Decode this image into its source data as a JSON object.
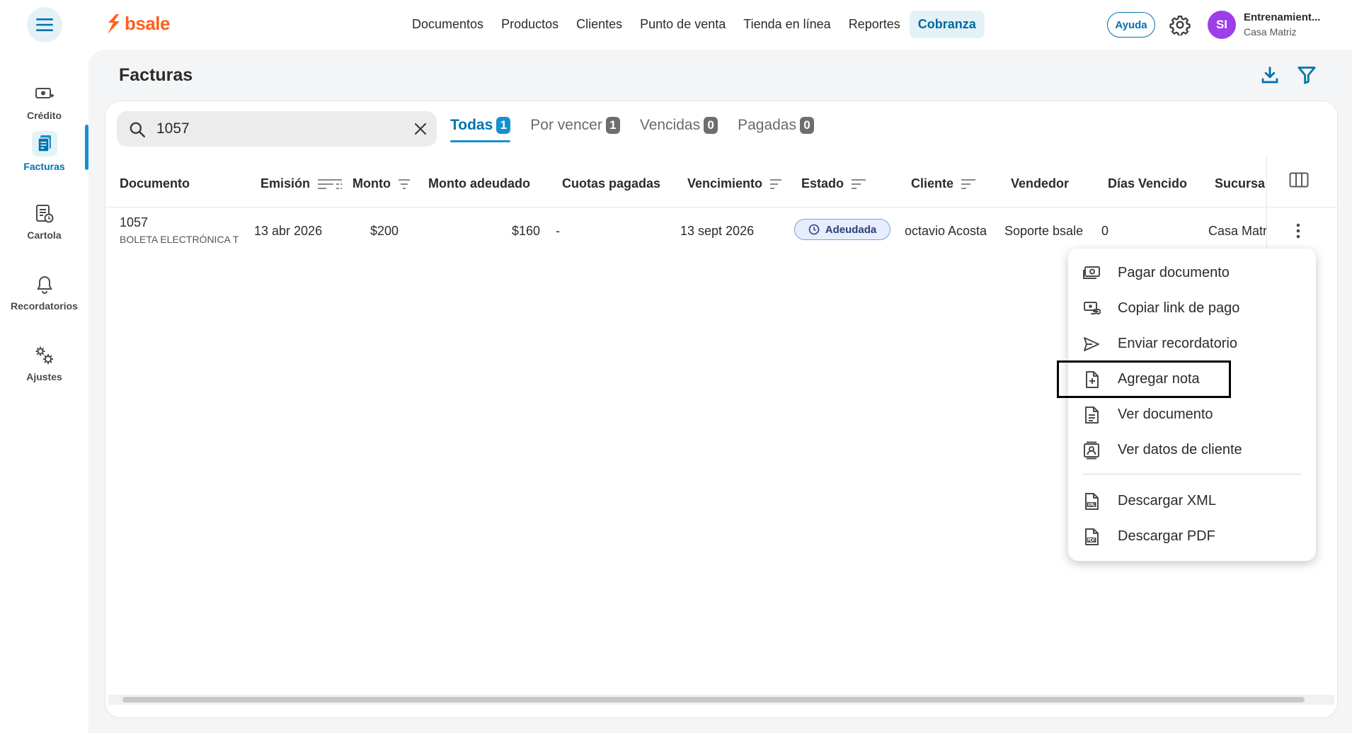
{
  "app": {
    "logo_text": "bsale",
    "brand_color": "#ff5f1f",
    "accent_color": "#1591d0"
  },
  "topnav": {
    "items": [
      {
        "label": "Documentos",
        "active": false
      },
      {
        "label": "Productos",
        "active": false
      },
      {
        "label": "Clientes",
        "active": false
      },
      {
        "label": "Punto de venta",
        "active": false
      },
      {
        "label": "Tienda en línea",
        "active": false
      },
      {
        "label": "Reportes",
        "active": false
      },
      {
        "label": "Cobranza",
        "active": true
      }
    ],
    "help_label": "Ayuda",
    "user": {
      "initials": "SI",
      "name": "Entrenamient...",
      "branch": "Casa Matriz"
    }
  },
  "sidebar": {
    "items": [
      {
        "label": "Crédito",
        "icon": "credit-icon",
        "active": false
      },
      {
        "label": "Facturas",
        "icon": "invoices-icon",
        "active": true
      },
      {
        "label": "Cartola",
        "icon": "statement-icon",
        "active": false
      },
      {
        "label": "Recordatorios",
        "icon": "bell-icon",
        "active": false
      },
      {
        "label": "Ajustes",
        "icon": "settings-icon",
        "active": false
      }
    ]
  },
  "page": {
    "title": "Facturas"
  },
  "search": {
    "value": "1057"
  },
  "tabs": [
    {
      "label": "Todas",
      "count": "1",
      "active": true
    },
    {
      "label": "Por vencer",
      "count": "1",
      "active": false
    },
    {
      "label": "Vencidas",
      "count": "0",
      "active": false
    },
    {
      "label": "Pagadas",
      "count": "0",
      "active": false
    }
  ],
  "table": {
    "columns": [
      "Documento",
      "Emisión",
      "Monto",
      "Monto adeudado",
      "Cuotas pagadas",
      "Vencimiento",
      "Estado",
      "Cliente",
      "Vendedor",
      "Días Vencido",
      "Sucursal"
    ],
    "rows": [
      {
        "documento": "1057",
        "tipo": "BOLETA ELECTRÓNICA T",
        "emision": "13 abr 2026",
        "monto": "$200",
        "monto_adeudado": "$160",
        "cuotas_pagadas": "-",
        "vencimiento": "13 sept 2026",
        "estado": "Adeudada",
        "cliente": "octavio Acosta",
        "vendedor": "Soporte bsale",
        "dias_vencido": "0",
        "sucursal": "Casa Matriz"
      }
    ]
  },
  "context_menu": {
    "items": [
      {
        "label": "Pagar documento",
        "icon": "cash-icon"
      },
      {
        "label": "Copiar link de pago",
        "icon": "link-cash-icon"
      },
      {
        "label": "Enviar recordatorio",
        "icon": "send-icon"
      },
      {
        "label": "Agregar nota",
        "icon": "add-note-icon"
      },
      {
        "label": "Ver documento",
        "icon": "document-icon"
      },
      {
        "label": "Ver datos de cliente",
        "icon": "contact-icon"
      },
      {
        "label": "Descargar XML",
        "icon": "xml-file-icon"
      },
      {
        "label": "Descargar PDF",
        "icon": "pdf-file-icon"
      }
    ]
  }
}
